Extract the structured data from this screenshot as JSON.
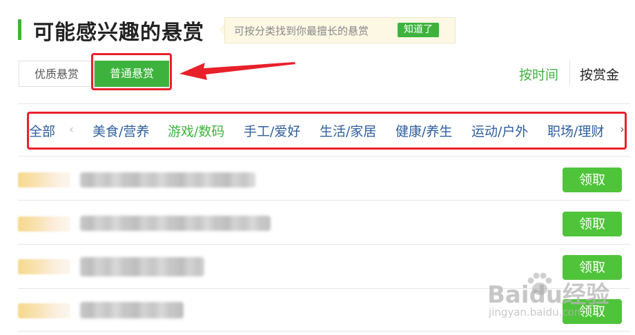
{
  "section": {
    "title": "可能感兴趣的悬赏",
    "tip_text": "可按分类找到你最擅长的悬赏",
    "tip_button": "知道了"
  },
  "tabs": [
    {
      "label": "优质悬赏",
      "active": false
    },
    {
      "label": "普通悬赏",
      "active": true
    }
  ],
  "sort": {
    "by_time": "按时间",
    "by_reward": "按赏金",
    "active": "by_time"
  },
  "categories": [
    {
      "label": "全部",
      "active": false
    },
    {
      "label": "美食/营养",
      "active": false
    },
    {
      "label": "游戏/数码",
      "active": true
    },
    {
      "label": "手工/爱好",
      "active": false
    },
    {
      "label": "生活/家居",
      "active": false
    },
    {
      "label": "健康/养生",
      "active": false
    },
    {
      "label": "运动/户外",
      "active": false
    },
    {
      "label": "职场/理财",
      "active": false
    }
  ],
  "rows": [
    {
      "claim_label": "领取"
    },
    {
      "claim_label": "领取"
    },
    {
      "claim_label": "领取"
    },
    {
      "claim_label": "领取"
    }
  ],
  "watermark": {
    "brand": "Baidu经验",
    "url": "jingyan.baidu.com"
  },
  "colors": {
    "accent_green": "#3db33d",
    "button_green": "#4fc43b",
    "link_blue": "#2e5e9e",
    "annotation_red": "#e8202a"
  },
  "icons": [
    "chevron-left-icon",
    "chevron-right-icon",
    "annotation-arrow-icon",
    "paw-icon"
  ]
}
